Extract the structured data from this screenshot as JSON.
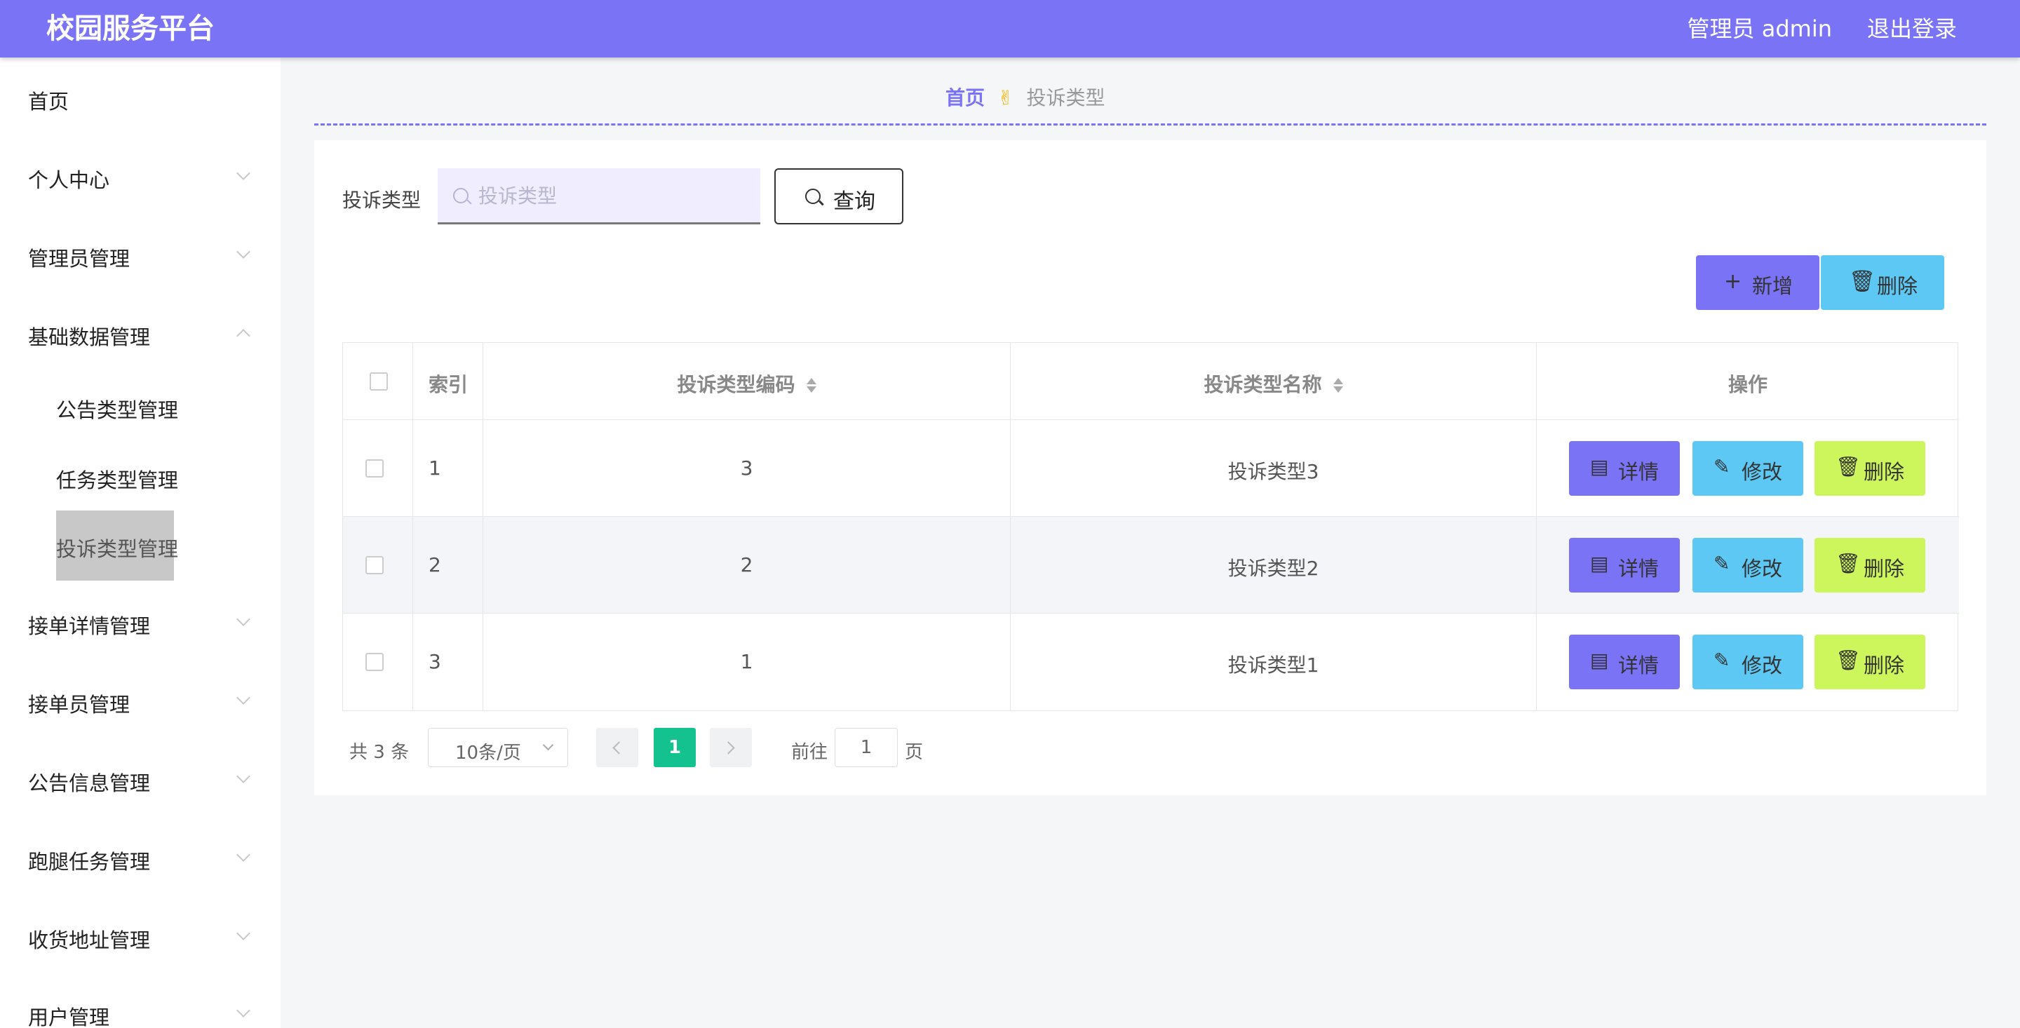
{
  "header": {
    "brand": "校园服务平台",
    "user": "管理员 admin",
    "logout": "退出登录"
  },
  "sidebar": {
    "items": [
      {
        "label": "首页"
      },
      {
        "label": "个人中心"
      },
      {
        "label": "管理员管理"
      },
      {
        "label": "基础数据管理"
      },
      {
        "label": "接单详情管理"
      },
      {
        "label": "接单员管理"
      },
      {
        "label": "公告信息管理"
      },
      {
        "label": "跑腿任务管理"
      },
      {
        "label": "收货地址管理"
      },
      {
        "label": "用户管理"
      }
    ],
    "subitems": [
      {
        "label": "公告类型管理"
      },
      {
        "label": "任务类型管理"
      },
      {
        "label": "投诉类型管理"
      }
    ]
  },
  "breadcrumb": {
    "home": "首页",
    "separator": "✌",
    "current": "投诉类型"
  },
  "search": {
    "label": "投诉类型",
    "placeholder": "投诉类型",
    "value": "",
    "query_button": "查询"
  },
  "toolbar": {
    "add": "新增",
    "delete": "删除"
  },
  "table": {
    "headers": {
      "index": "索引",
      "code": "投诉类型编码",
      "name": "投诉类型名称",
      "ops": "操作"
    },
    "rows": [
      {
        "index": "1",
        "code": "3",
        "name": "投诉类型3"
      },
      {
        "index": "2",
        "code": "2",
        "name": "投诉类型2"
      },
      {
        "index": "3",
        "code": "1",
        "name": "投诉类型1"
      }
    ],
    "row_actions": {
      "detail": "详情",
      "edit": "修改",
      "delete": "删除"
    }
  },
  "pagination": {
    "total": "共 3 条",
    "page_size": "10条/页",
    "current_page": "1",
    "goto_label": "前往",
    "goto_value": "1",
    "page_unit": "页"
  },
  "colors": {
    "primary": "#7b73f5",
    "info": "#5ec8f5",
    "danger_lime": "#cdf65d",
    "page_active": "#13c28e"
  }
}
